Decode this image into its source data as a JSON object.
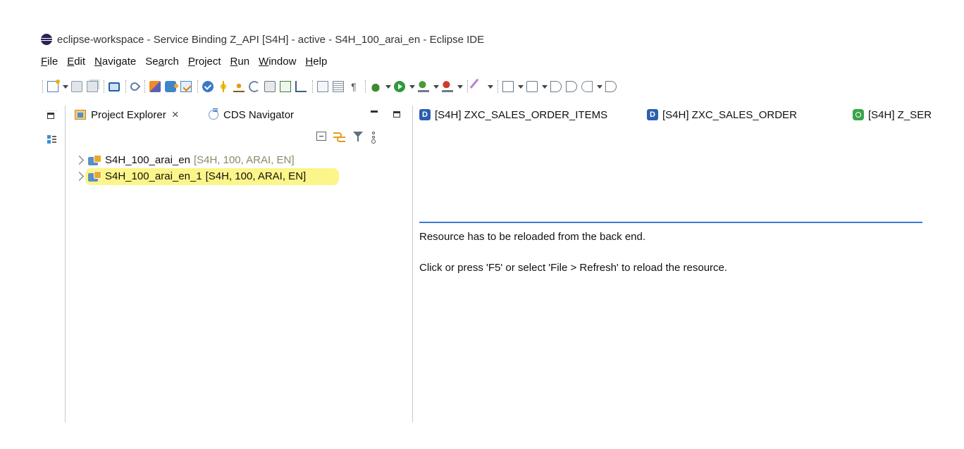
{
  "window": {
    "title": "eclipse-workspace - Service Binding Z_API [S4H]  - active - S4H_100_arai_en - Eclipse IDE"
  },
  "menu": [
    {
      "pre": "",
      "u": "F",
      "post": "ile"
    },
    {
      "pre": "",
      "u": "E",
      "post": "dit"
    },
    {
      "pre": "",
      "u": "N",
      "post": "avigate"
    },
    {
      "pre": "Se",
      "u": "a",
      "post": "rch"
    },
    {
      "pre": "",
      "u": "P",
      "post": "roject"
    },
    {
      "pre": "",
      "u": "R",
      "post": "un"
    },
    {
      "pre": "",
      "u": "W",
      "post": "indow"
    },
    {
      "pre": "",
      "u": "H",
      "post": "elp"
    }
  ],
  "left_view": {
    "tabs": [
      {
        "label": "Project Explorer",
        "active": true
      },
      {
        "label": "CDS Navigator",
        "active": false
      }
    ],
    "tree": [
      {
        "name": "S4H_100_arai_en",
        "meta": "[S4H, 100, ARAI, EN]"
      },
      {
        "name": "S4H_100_arai_en_1",
        "meta": "[S4H, 100, ARAI, EN]",
        "highlighted": true
      }
    ]
  },
  "editor": {
    "tabs": [
      {
        "icon": "D",
        "label": "[S4H] ZXC_SALES_ORDER_ITEMS"
      },
      {
        "icon": "D",
        "label": "[S4H] ZXC_SALES_ORDER"
      },
      {
        "icon": "service-binding",
        "label": "[S4H] Z_SER"
      }
    ],
    "message_1": "Resource has to be reloaded from the back end.",
    "message_2": "Click or press 'F5' or select 'File > Refresh' to reload the resource."
  },
  "colors": {
    "accent_blue": "#3b7ad6",
    "highlight": "#fbf36c"
  }
}
